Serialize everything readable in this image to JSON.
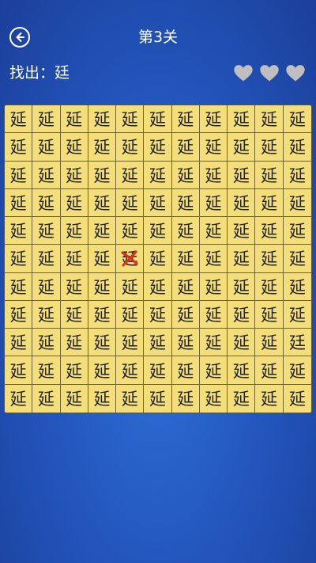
{
  "header": {
    "level_title": "第3关",
    "back_icon": "back-arrow-icon"
  },
  "target": {
    "label": "找出：廷"
  },
  "lives": {
    "total": 3,
    "icon": "heart-icon",
    "color": "#bfbfbf"
  },
  "board": {
    "rows": 11,
    "cols": 11,
    "default_char": "延",
    "odd_cells": [
      {
        "row": 6,
        "col": 5,
        "char": "廷",
        "mark": "cross-icon"
      },
      {
        "row": 9,
        "col": 11,
        "char": "廷"
      }
    ],
    "cell_color": "#f3de7a",
    "mark_color": "#d9361a"
  }
}
